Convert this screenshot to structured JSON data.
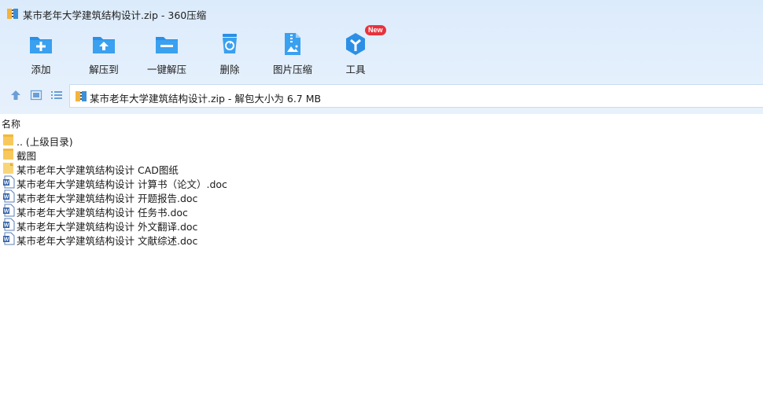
{
  "window": {
    "title": "某市老年大学建筑结构设计.zip - 360压缩"
  },
  "toolbar": {
    "items": [
      {
        "label": "添加",
        "icon": "add-folder-icon"
      },
      {
        "label": "解压到",
        "icon": "extract-to-icon"
      },
      {
        "label": "一键解压",
        "icon": "one-click-extract-icon"
      },
      {
        "label": "删除",
        "icon": "delete-icon"
      },
      {
        "label": "图片压缩",
        "icon": "image-compress-icon"
      },
      {
        "label": "工具",
        "icon": "tools-icon",
        "badge": "New"
      }
    ]
  },
  "nav": {
    "buttons": [
      "up-icon",
      "view-icon",
      "list-view-icon"
    ]
  },
  "address": {
    "text": "某市老年大学建筑结构设计.zip - 解包大小为 6.7 MB"
  },
  "list": {
    "header": "名称",
    "rows": [
      {
        "name": ".. (上级目录)",
        "type": "folder"
      },
      {
        "name": "截图",
        "type": "folder"
      },
      {
        "name": "某市老年大学建筑结构设计 CAD图纸",
        "type": "file"
      },
      {
        "name": "某市老年大学建筑结构设计 计算书（论文）.doc",
        "type": "doc"
      },
      {
        "name": "某市老年大学建筑结构设计 开题报告.doc",
        "type": "doc"
      },
      {
        "name": "某市老年大学建筑结构设计 任务书.doc",
        "type": "doc"
      },
      {
        "name": "某市老年大学建筑结构设计 外文翻译.doc",
        "type": "doc"
      },
      {
        "name": "某市老年大学建筑结构设计 文献综述.doc",
        "type": "doc"
      }
    ]
  },
  "colors": {
    "accent": "#2b8fe6",
    "chrome_bg": "#e3effc",
    "folder": "#f7c95c",
    "badge": "#e8323c"
  }
}
